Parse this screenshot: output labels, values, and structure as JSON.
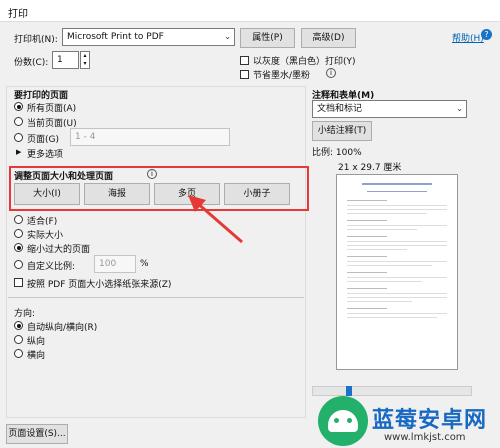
{
  "window": {
    "title": "打印"
  },
  "printer": {
    "label": "打印机(N):",
    "value": "Microsoft Print to PDF",
    "properties": "属性(P)",
    "advanced": "高级(D)",
    "help": "帮助(H)"
  },
  "copies": {
    "label": "份数(C):",
    "value": "1"
  },
  "options": {
    "grayscale": "以灰度（黑白色）打印(Y)",
    "save_ink": "节省墨水/墨粉"
  },
  "pages": {
    "title": "要打印的页面",
    "all": "所有页面(A)",
    "current": "当前页面(U)",
    "range": "页面(G)",
    "range_value": "1 - 4",
    "more": "更多选项"
  },
  "sizing": {
    "title": "调整页面大小和处理页面",
    "buttons": [
      "大小(I)",
      "海报",
      "多页",
      "小册子"
    ],
    "fit": "适合(F)",
    "actual": "实际大小",
    "shrink": "缩小过大的页面",
    "custom": "自定义比例:",
    "custom_value": "100",
    "percent": "%",
    "paper_source": "按照 PDF 页面大小选择纸张来源(Z)"
  },
  "orientation": {
    "title": "方向:",
    "auto": "自动纵向/横向(R)",
    "portrait": "纵向",
    "landscape": "横向"
  },
  "comments": {
    "title": "注释和表单(M)",
    "value": "文档和标记",
    "summarize": "小结注释(T)"
  },
  "preview": {
    "scale": "比例: 100%",
    "size": "21 x 29.7 厘米"
  },
  "footer": {
    "page_setup": "页面设置(S)..."
  },
  "watermark": {
    "text": "蓝莓安卓网",
    "url": "www.lmkjst.com"
  },
  "colors": {
    "highlight": "#e53935",
    "accent": "#0063b1"
  }
}
